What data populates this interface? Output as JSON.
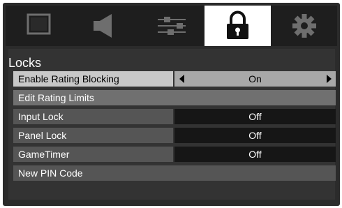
{
  "tabs": [
    {
      "icon": "picture-icon"
    },
    {
      "icon": "speaker-icon"
    },
    {
      "icon": "settings-sliders-icon"
    },
    {
      "icon": "lock-icon",
      "active": true
    },
    {
      "icon": "gear-icon"
    }
  ],
  "menu": {
    "title": "Locks",
    "rows": [
      {
        "label": "Enable Rating Blocking",
        "value": "On",
        "selected": true
      },
      {
        "label": "Edit Rating Limits"
      },
      {
        "label": "Input Lock",
        "value": "Off"
      },
      {
        "label": "Panel Lock",
        "value": "Off"
      },
      {
        "label": "GameTimer",
        "value": "Off"
      },
      {
        "label": "New PIN Code"
      }
    ]
  },
  "colors": {
    "background": "#2b2b2b",
    "active_tab": "#ffffff",
    "selected_row": "#c8c8c8"
  }
}
